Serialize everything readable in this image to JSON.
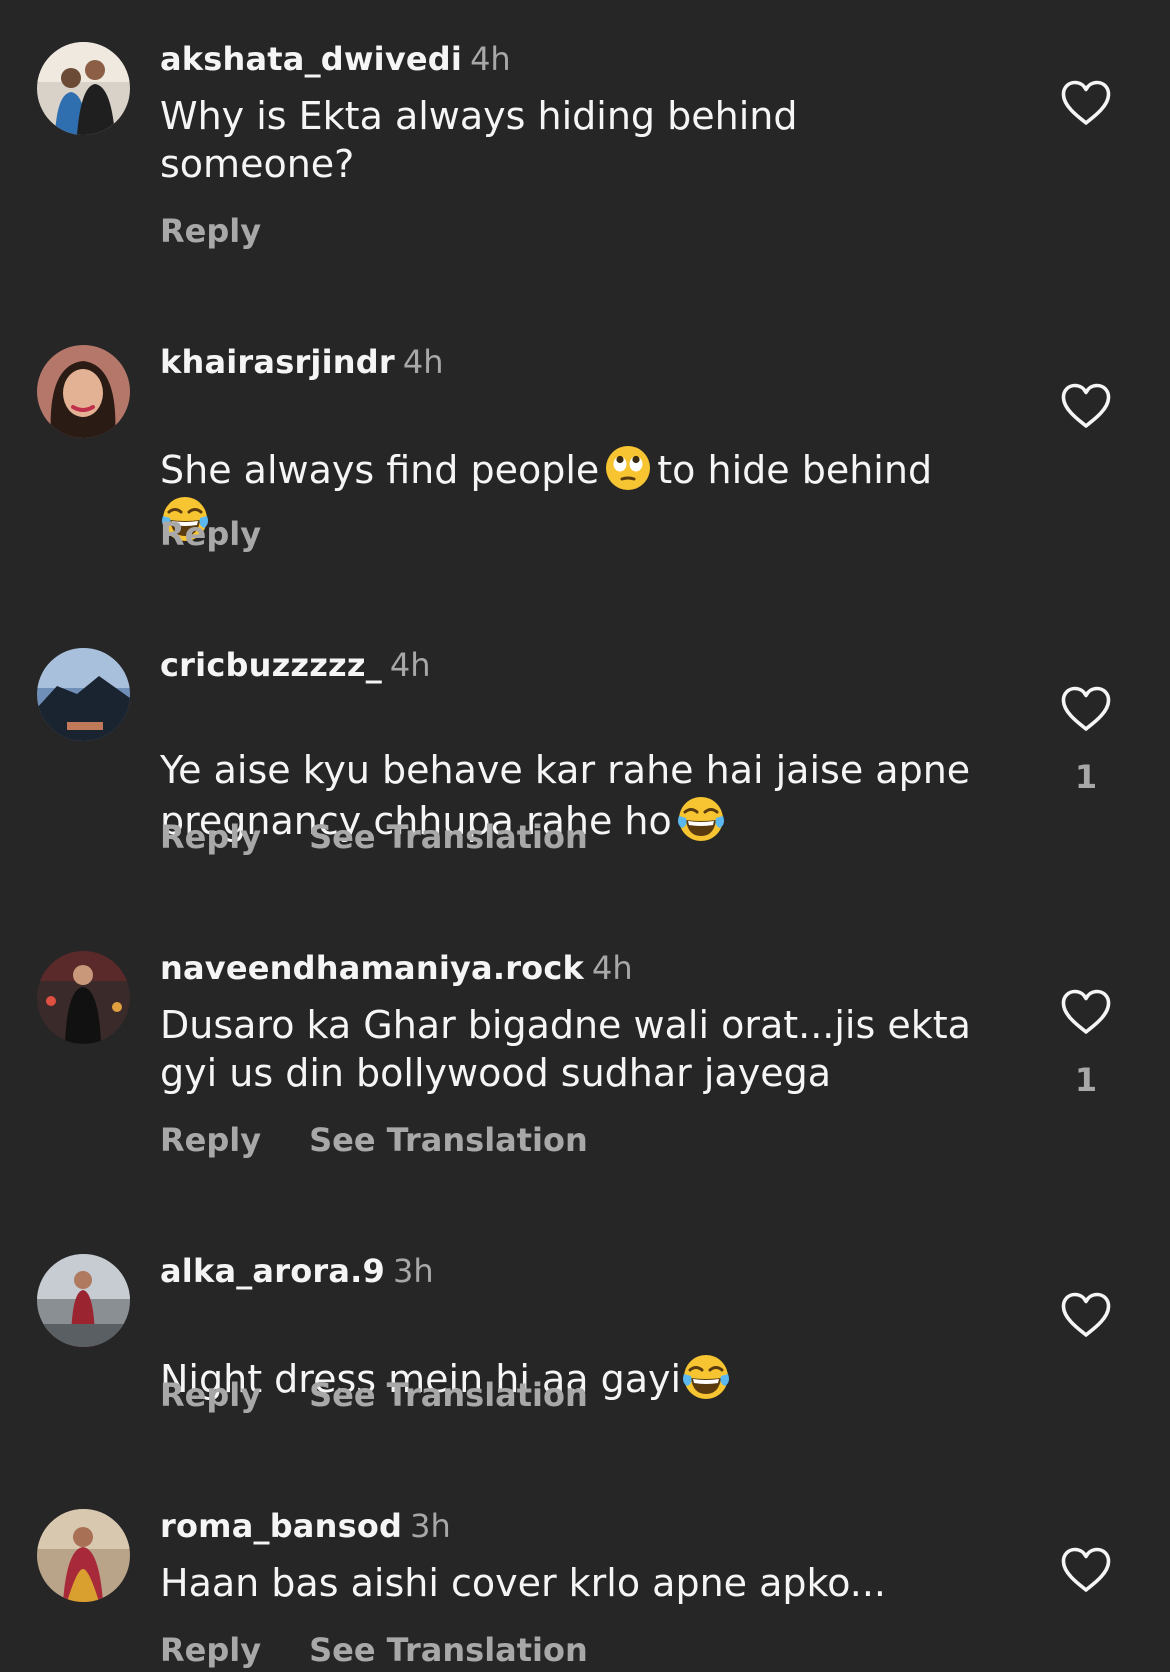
{
  "comments": [
    {
      "username": "akshata_dwivedi",
      "time": "4h",
      "text": "Why is Ekta always hiding behind\nsomeone?",
      "reply": "Reply"
    },
    {
      "username": "khairasrjindr",
      "time": "4h",
      "text_a": "She always find people",
      "text_b": "to hide behind",
      "emoji_1": "face-with-rolling-eyes-emoji",
      "emoji_2": "face-with-tears-of-joy-emoji",
      "reply": "Reply"
    },
    {
      "username": "cricbuzzzzz_",
      "time": "4h",
      "text_a": "Ye aise kyu behave kar rahe hai jaise apne",
      "text_b": "pregnancy chhupa rahe ho",
      "emoji_1": "face-with-tears-of-joy-emoji",
      "reply": "Reply",
      "translate": "See Translation",
      "likes": "1"
    },
    {
      "username": "naveendhamaniya.rock",
      "time": "4h",
      "text": "Dusaro ka Ghar bigadne wali orat...jis ekta\ngyi us din bollywood sudhar jayega",
      "reply": "Reply",
      "translate": "See Translation",
      "likes": "1"
    },
    {
      "username": "alka_arora.9",
      "time": "3h",
      "text_a": "Night dress mein hi aa gayi",
      "emoji_1": "face-with-tears-of-joy-emoji",
      "reply": "Reply",
      "translate": "See Translation"
    },
    {
      "username": "roma_bansod",
      "time": "3h",
      "text": "Haan bas aishi cover krlo apne apko...",
      "reply": "Reply",
      "translate": "See Translation"
    }
  ],
  "colors": {
    "background": "#262626",
    "primary_text": "#f5f5f5",
    "secondary_text": "#a8a8a8"
  },
  "icons": {
    "like": "heart-outline-icon"
  }
}
